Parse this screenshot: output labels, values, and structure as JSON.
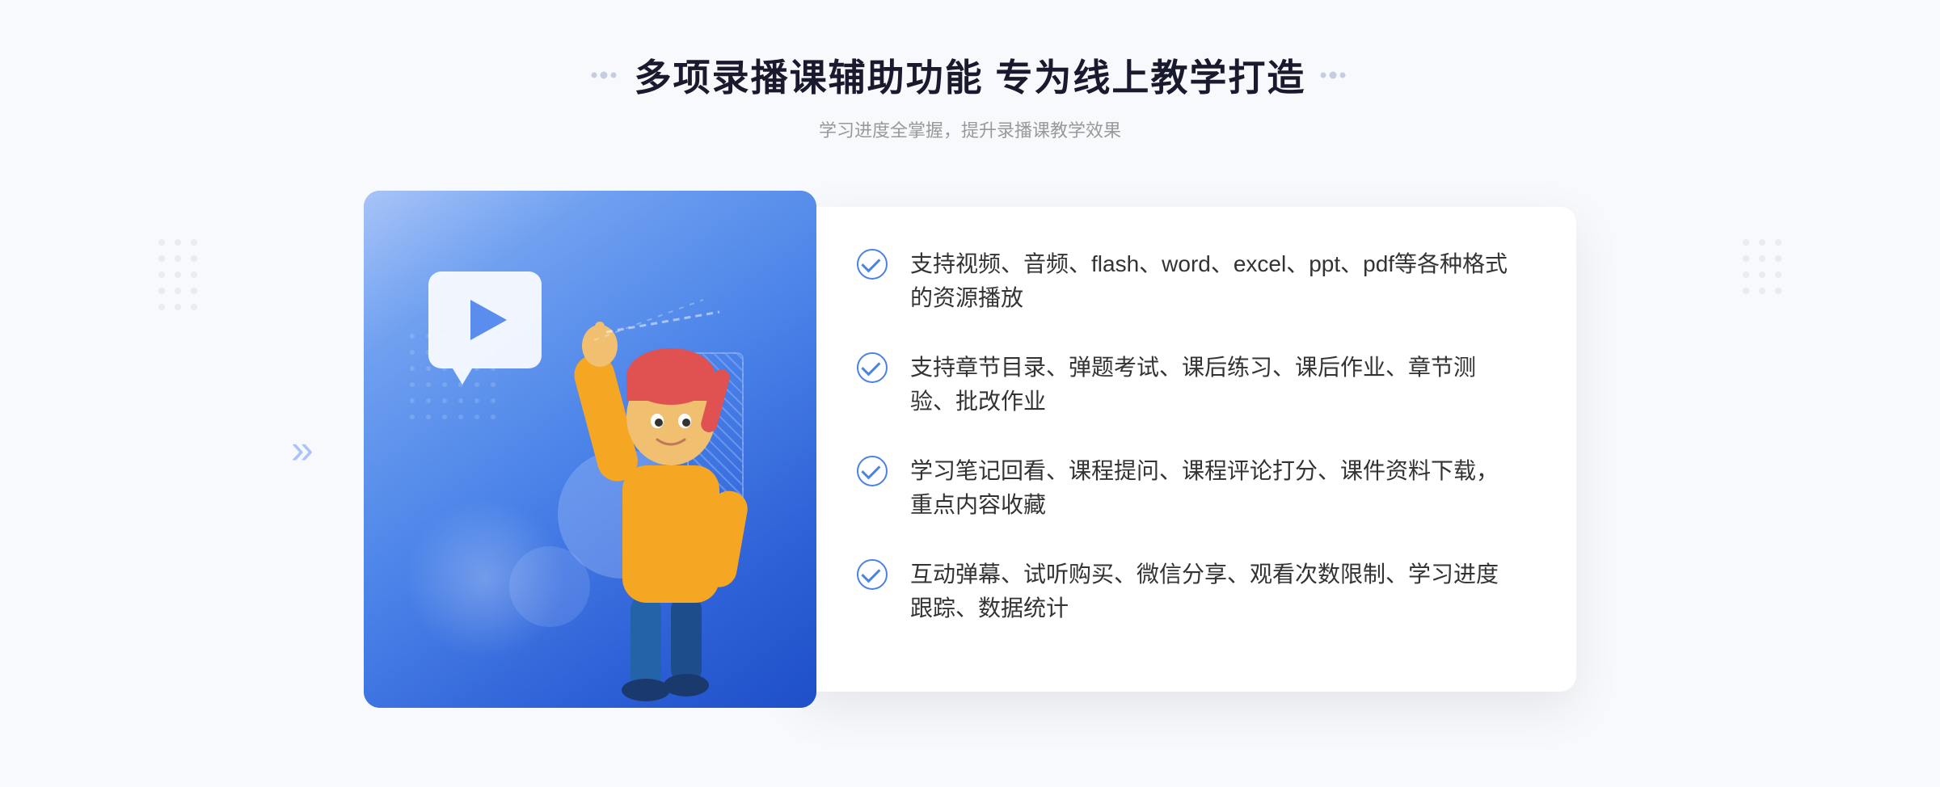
{
  "header": {
    "title": "多项录播课辅助功能 专为线上教学打造",
    "subtitle": "学习进度全掌握，提升录播课教学效果",
    "deco_left": "decorative",
    "deco_right": "decorative"
  },
  "features": [
    {
      "id": 1,
      "text": "支持视频、音频、flash、word、excel、ppt、pdf等各种格式的资源播放"
    },
    {
      "id": 2,
      "text": "支持章节目录、弹题考试、课后练习、课后作业、章节测验、批改作业"
    },
    {
      "id": 3,
      "text": "学习笔记回看、课程提问、课程评论打分、课件资料下载，重点内容收藏"
    },
    {
      "id": 4,
      "text": "互动弹幕、试听购买、微信分享、观看次数限制、学习进度跟踪、数据统计"
    }
  ],
  "illustration": {
    "play_button": "▶",
    "arrow_left": "»"
  },
  "colors": {
    "primary": "#4a82e8",
    "primary_light": "#a8c4f8",
    "card_bg": "#ffffff",
    "text_main": "#333333",
    "text_sub": "#999999",
    "title_color": "#1a1a2e",
    "gradient_start": "#7fb0f5",
    "gradient_end": "#2a5bd4"
  }
}
